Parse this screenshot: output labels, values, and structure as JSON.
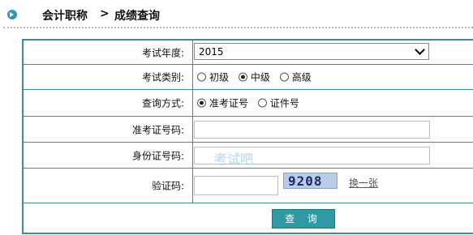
{
  "breadcrumb": {
    "section": "会计职称",
    "separator": ">",
    "page": "成绩查询"
  },
  "watermark": "考试吧",
  "form": {
    "year": {
      "label": "考试年度:",
      "value": "2015"
    },
    "category": {
      "label": "考试类别:",
      "options": [
        {
          "label": "初级",
          "selected": false
        },
        {
          "label": "中级",
          "selected": true
        },
        {
          "label": "高级",
          "selected": false
        }
      ]
    },
    "method": {
      "label": "查询方式:",
      "options": [
        {
          "label": "准考证号",
          "selected": true
        },
        {
          "label": "证件号",
          "selected": false
        }
      ]
    },
    "ticket_number": {
      "label": "准考证号码:",
      "value": ""
    },
    "id_number": {
      "label": "身份证号码:",
      "value": ""
    },
    "captcha": {
      "label": "验证码:",
      "value": "",
      "image_text": "9208",
      "refresh_label": "换一张"
    },
    "submit_label": "查 询"
  },
  "colors": {
    "accent": "#2f9aa4",
    "border": "#3e8c9a"
  }
}
